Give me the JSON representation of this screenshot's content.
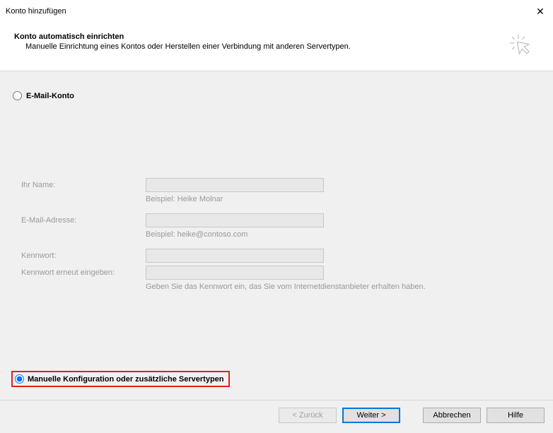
{
  "window": {
    "title": "Konto hinzufügen"
  },
  "header": {
    "title": "Konto automatisch einrichten",
    "subtitle": "Manuelle Einrichtung eines Kontos oder Herstellen einer Verbindung mit anderen Servertypen."
  },
  "options": {
    "email_account_label": "E-Mail-Konto",
    "manual_config_label": "Manuelle Konfiguration oder zusätzliche Servertypen"
  },
  "form": {
    "name_label": "Ihr Name:",
    "name_hint": "Beispiel: Heike Molnar",
    "email_label": "E-Mail-Adresse:",
    "email_hint": "Beispiel: heike@contoso.com",
    "password_label": "Kennwort:",
    "password_repeat_label": "Kennwort erneut eingeben:",
    "password_hint": "Geben Sie das Kennwort ein, das Sie vom Internetdienstanbieter erhalten haben."
  },
  "buttons": {
    "back": "< Zurück",
    "next": "Weiter >",
    "cancel": "Abbrechen",
    "help": "Hilfe"
  }
}
